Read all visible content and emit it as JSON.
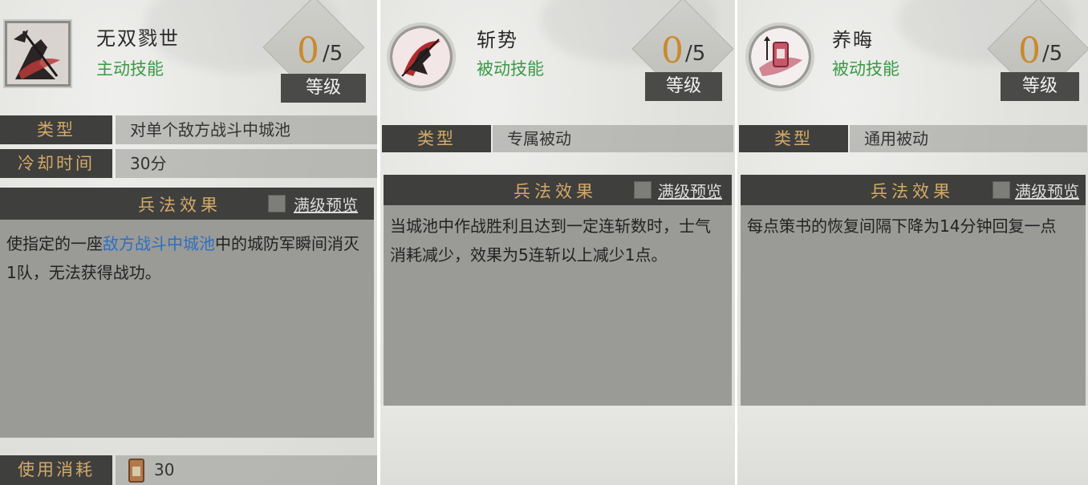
{
  "panels": [
    {
      "name": "无双戮世",
      "skill_type": "主动技能",
      "icon": "warrior-skill-icon",
      "level": {
        "current": "0",
        "max": "/5",
        "tag": "等级"
      },
      "rows": [
        {
          "label": "类型",
          "value": "对单个敌方战斗中城池"
        },
        {
          "label": "冷却时间",
          "value": "30分"
        }
      ],
      "effect": {
        "title": "兵法效果",
        "preview_label": "满级预览",
        "text_before": "使指定的一座",
        "text_highlight": "敌方战斗中城池",
        "text_after": "中的城防军瞬间消灭1队，无法获得战功。"
      },
      "cost": {
        "label": "使用消耗",
        "value": "30",
        "icon": "strategy-book-icon"
      }
    },
    {
      "name": "斩势",
      "skill_type": "被动技能",
      "icon": "slash-skill-icon",
      "level": {
        "current": "0",
        "max": "/5",
        "tag": "等级"
      },
      "rows": [
        {
          "label": "类型",
          "value": "专属被动"
        }
      ],
      "effect": {
        "title": "兵法效果",
        "preview_label": "满级预览",
        "text": "当城池中作战胜利且达到一定连斩数时，士气消耗减少，效果为5连斩以上减少1点。"
      }
    },
    {
      "name": "养晦",
      "skill_type": "被动技能",
      "icon": "talisman-skill-icon",
      "level": {
        "current": "0",
        "max": "/5",
        "tag": "等级"
      },
      "rows": [
        {
          "label": "类型",
          "value": "通用被动"
        }
      ],
      "effect": {
        "title": "兵法效果",
        "preview_label": "满级预览",
        "text": "每点策书的恢复间隔下降为14分钟回复一点"
      }
    }
  ],
  "colors": {
    "skill_type_green": "#3a9a45",
    "level_gold": "#c98a2d",
    "label_gold": "#d3a96a",
    "highlight_blue": "#2d6fc1",
    "dark_bar": "#3f3f3d"
  }
}
